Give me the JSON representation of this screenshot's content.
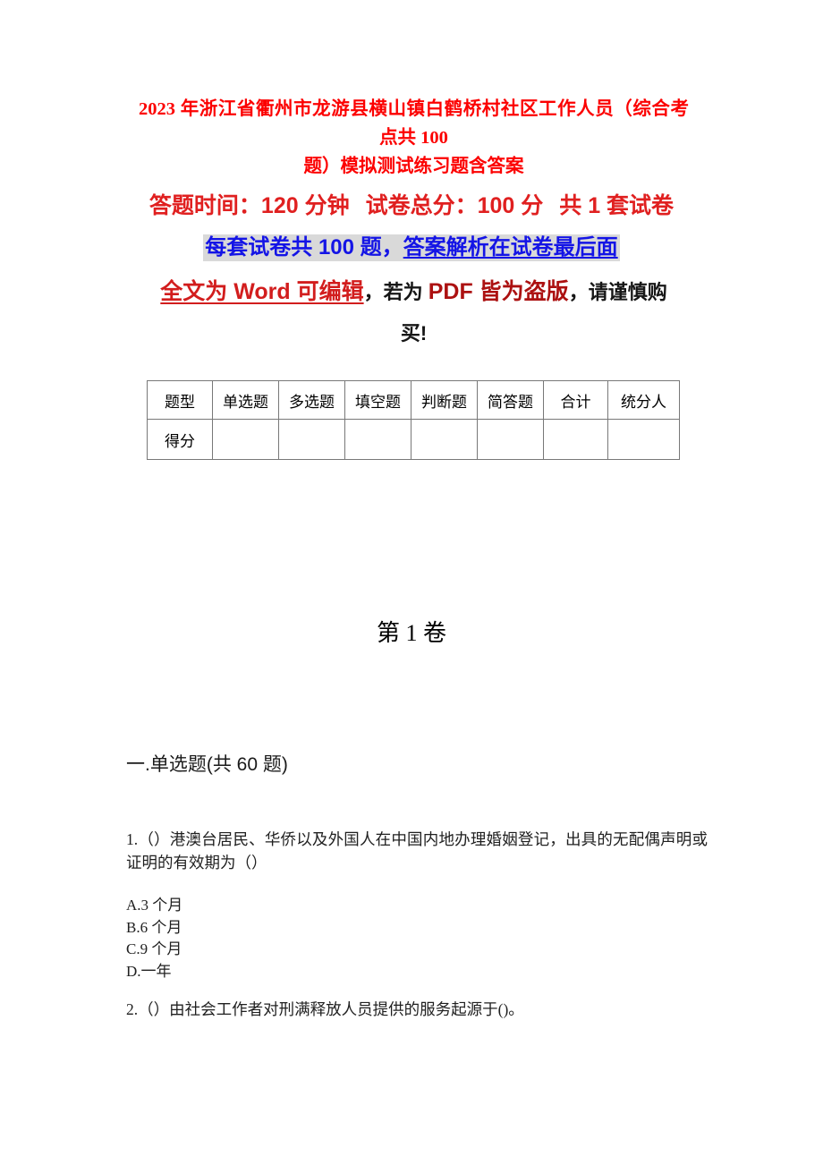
{
  "document": {
    "title_line1": "2023 年浙江省衢州市龙游县横山镇白鹤桥村社区工作人员（综合考点共 100",
    "title_line2": "题）模拟测试练习题含答案",
    "title_color": "#fc0000"
  },
  "exam_info": {
    "time_label": "答题时间：120 分钟",
    "total_score_label": "试卷总分：100 分",
    "set_count_label": "共 1 套试卷",
    "info_color": "#e02020",
    "highlight_line_part1": "每套试卷共 100 题，",
    "highlight_line_part2": "答案解析在试卷最后面",
    "highlight_bg": "#d9d9d9",
    "highlight_color": "#1414e6",
    "notice_red": "全文为 Word 可编辑",
    "notice_sep1": "，若为 ",
    "notice_dark_red": "PDF 皆为盗版",
    "notice_sep2": "，请谨慎购",
    "notice_last": "买!",
    "notice_red_color": "#d21d1d",
    "notice_dark_red_color": "#ac1111"
  },
  "score_table": {
    "headers": [
      "题型",
      "单选题",
      "多选题",
      "填空题",
      "判断题",
      "简答题",
      "合计",
      "统分人"
    ],
    "rows": [
      {
        "label": "得分",
        "cells": [
          "",
          "",
          "",
          "",
          "",
          "",
          ""
        ]
      }
    ]
  },
  "volume": {
    "heading": "第 1 卷"
  },
  "section": {
    "heading": "一.单选题(共 60 题)"
  },
  "questions": [
    {
      "text": "1.（）港澳台居民、华侨以及外国人在中国内地办理婚姻登记，出具的无配偶声明或证明的有效期为（）",
      "options": [
        "A.3 个月",
        "B.6 个月",
        "C.9 个月",
        "D.一年"
      ]
    },
    {
      "text": "2.（）由社会工作者对刑满释放人员提供的服务起源于()。",
      "options": []
    }
  ]
}
